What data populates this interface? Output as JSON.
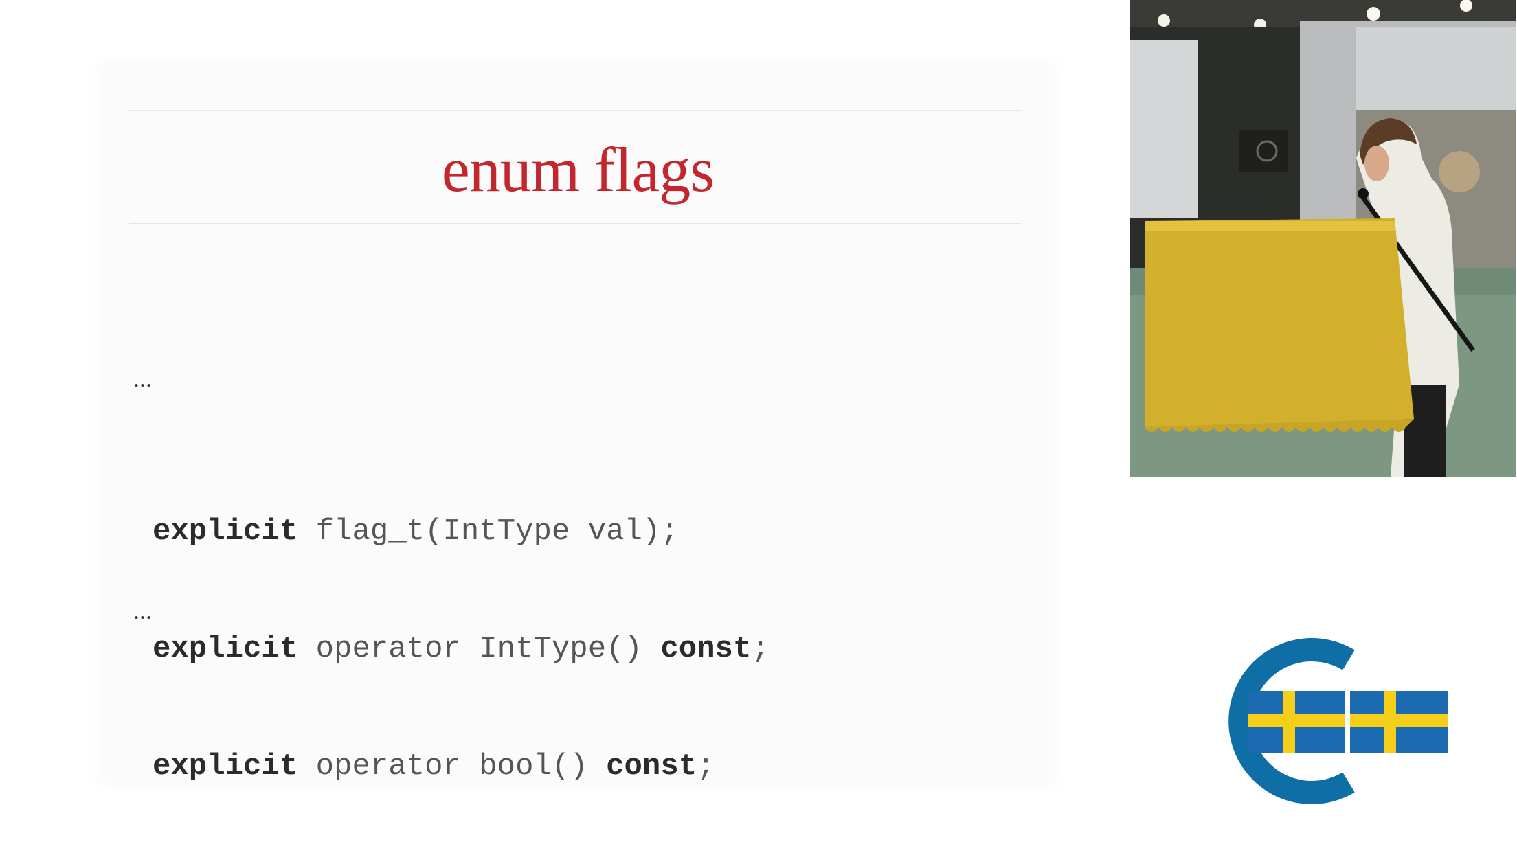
{
  "slide": {
    "title": "enum flags",
    "ellipsis_top": "...",
    "ellipsis_bottom": "...",
    "code_lines": [
      {
        "keyword": "explicit",
        "rest": " flag_t(IntType val);",
        "trailing_keyword": "",
        "trailing": ""
      },
      {
        "keyword": "explicit",
        "rest": " operator IntType() ",
        "trailing_keyword": "const",
        "trailing": ";"
      },
      {
        "keyword": "explicit",
        "rest": " operator bool() ",
        "trailing_keyword": "const",
        "trailing": ";"
      }
    ]
  },
  "video": {
    "subject": "speaker-at-podium"
  },
  "logo": {
    "icon": "conference-logo-swedish-flag",
    "colors": {
      "ring": "#0f6ea6",
      "flag_blue": "#1c6bb0",
      "flag_yellow": "#f6cf1b"
    }
  },
  "colors": {
    "title": "#c4262e",
    "code_keyword": "#2b2b2b",
    "code_text": "#555555",
    "slide_bg": "#fbfbfb"
  }
}
